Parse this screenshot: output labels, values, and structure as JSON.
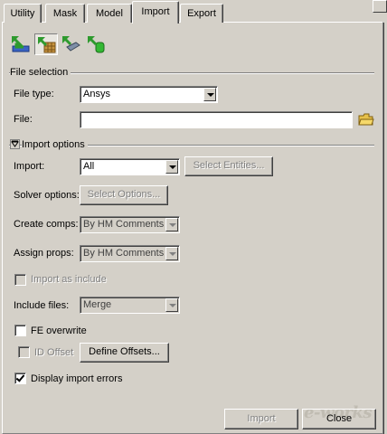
{
  "tabs": [
    {
      "label": "Utility",
      "active": false
    },
    {
      "label": "Mask",
      "active": false
    },
    {
      "label": "Model",
      "active": false
    },
    {
      "label": "Import",
      "active": true
    },
    {
      "label": "Export",
      "active": false
    }
  ],
  "toolbar": {
    "icons": [
      "import-solver-deck-icon",
      "import-model-icon",
      "import-geometry-icon",
      "import-connectors-icon"
    ]
  },
  "file_selection": {
    "header": "File selection",
    "file_type_label": "File type:",
    "file_type_value": "Ansys",
    "file_label": "File:",
    "file_value": ""
  },
  "import_options": {
    "header": "Import options",
    "import_label": "Import:",
    "import_value": "All",
    "select_entities": "Select Entities...",
    "solver_label": "Solver options:",
    "select_options": "Select Options...",
    "create_comps_label": "Create comps:",
    "create_comps_value": "By HM Comments",
    "assign_props_label": "Assign props:",
    "assign_props_value": "By HM Comments",
    "import_as_include": "Import as include",
    "include_files_label": "Include files:",
    "include_files_value": "Merge",
    "fe_overwrite": "FE overwrite",
    "id_offset": "ID Offset",
    "define_offsets": "Define Offsets...",
    "display_errors": "Display import errors"
  },
  "footer": {
    "import_button": "Import",
    "close_button": "Close"
  },
  "watermark": "e-works",
  "colors": {
    "panel": "#d4d0c8",
    "icon_green": "#2e9a2e",
    "icon_blue": "#2b56b8"
  }
}
